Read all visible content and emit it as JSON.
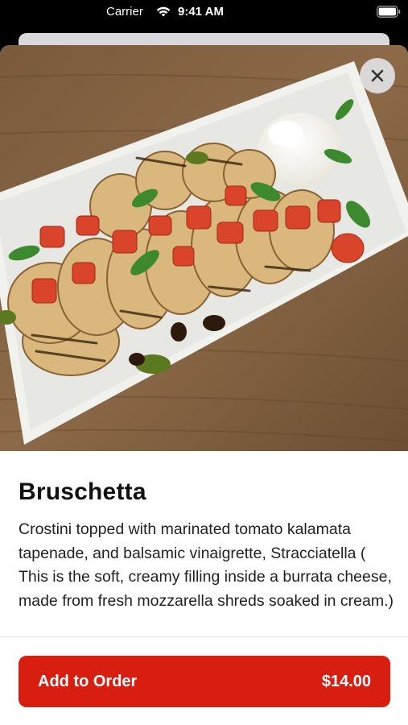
{
  "status_bar": {
    "carrier": "Carrier",
    "time": "9:41 AM"
  },
  "hero": {
    "icon": "bruschetta-photo"
  },
  "close": {
    "icon": "close-icon"
  },
  "item": {
    "title": "Bruschetta",
    "description": "Crostini topped with marinated tomato kalamata tapenade, and balsamic vinaigrette, Stracciatella ( This is the soft, creamy filling inside a burrata cheese, made from fresh mozzarella shreds soaked in cream.)"
  },
  "order_button": {
    "label": "Add to Order",
    "price": "$14.00",
    "color": "#d71e10"
  }
}
